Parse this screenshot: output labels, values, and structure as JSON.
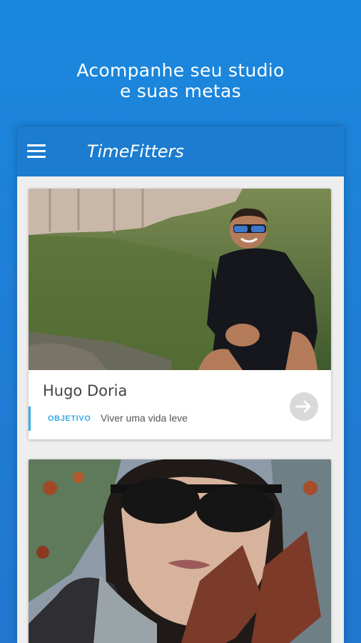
{
  "headline": {
    "line1": "Acompanhe seu studio",
    "line2": "e suas metas"
  },
  "app": {
    "title": "TimeFitters",
    "menu_icon": "hamburger-menu-icon"
  },
  "cards": [
    {
      "name": "Hugo Doria",
      "goal_label": "OBJETIVO",
      "goal_text": "Viver uma vida leve",
      "action_icon": "arrow-right-icon"
    },
    {
      "photo": "portrait-photo"
    }
  ],
  "colors": {
    "background": "#1e7fd6",
    "appbar": "#1c7ccf",
    "accent": "#32aee9",
    "card": "#ffffff"
  }
}
